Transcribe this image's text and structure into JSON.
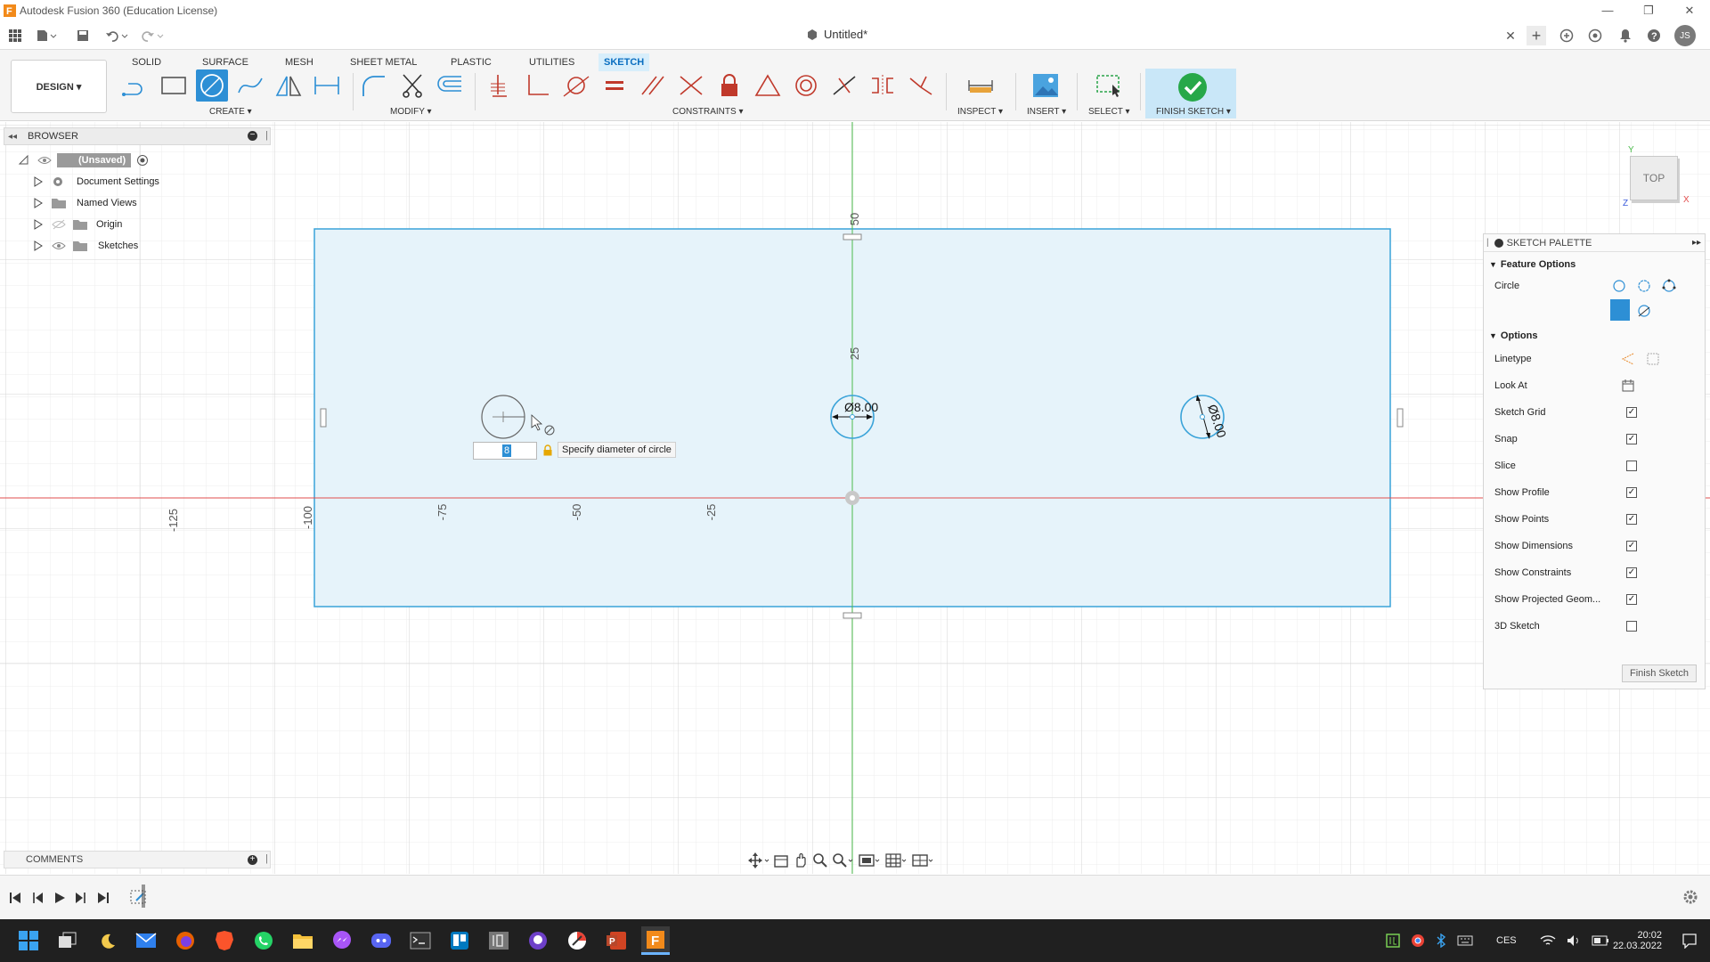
{
  "window": {
    "title": "Autodesk Fusion 360 (Education License)",
    "document_title": "Untitled*",
    "user_initials": "JS"
  },
  "workspace_tabs": [
    "SOLID",
    "SURFACE",
    "MESH",
    "SHEET METAL",
    "PLASTIC",
    "UTILITIES",
    "SKETCH"
  ],
  "active_workspace_tab": "SKETCH",
  "toolbar": {
    "design_label": "DESIGN ▾",
    "groups": {
      "create": "CREATE ▾",
      "modify": "MODIFY ▾",
      "constraints": "CONSTRAINTS ▾",
      "inspect": "INSPECT ▾",
      "insert": "INSERT ▾",
      "select": "SELECT ▾",
      "finish_sketch": "FINISH SKETCH ▾"
    },
    "active_tool": "circle-center-diameter"
  },
  "browser": {
    "title": "BROWSER",
    "root": "(Unsaved)",
    "items": [
      "Document Settings",
      "Named Views",
      "Origin",
      "Sketches"
    ]
  },
  "viewcube": {
    "face": "TOP",
    "axes": [
      "Y",
      "X",
      "Z"
    ]
  },
  "sketch": {
    "ruler_ticks_x": [
      "-125",
      "-100",
      "-75",
      "-50",
      "-25"
    ],
    "ruler_ticks_y": [
      "50",
      "25"
    ],
    "dimension_1": "Ø8.00",
    "dimension_2": "Ø8.00",
    "input_value": "8",
    "tooltip": "Specify diameter of circle"
  },
  "palette": {
    "title": "SKETCH PALETTE",
    "feature_options_label": "Feature Options",
    "circle_label": "Circle",
    "options_label": "Options",
    "options": [
      {
        "label": "Linetype",
        "kind": "icon"
      },
      {
        "label": "Look At",
        "kind": "icon"
      },
      {
        "label": "Sketch Grid",
        "kind": "check",
        "checked": true
      },
      {
        "label": "Snap",
        "kind": "check",
        "checked": true
      },
      {
        "label": "Slice",
        "kind": "check",
        "checked": false
      },
      {
        "label": "Show Profile",
        "kind": "check",
        "checked": true
      },
      {
        "label": "Show Points",
        "kind": "check",
        "checked": true
      },
      {
        "label": "Show Dimensions",
        "kind": "check",
        "checked": true
      },
      {
        "label": "Show Constraints",
        "kind": "check",
        "checked": true
      },
      {
        "label": "Show Projected Geom...",
        "kind": "check",
        "checked": true
      },
      {
        "label": "3D Sketch",
        "kind": "check",
        "checked": false
      }
    ],
    "finish_button": "Finish Sketch"
  },
  "comments": {
    "label": "COMMENTS"
  },
  "taskbar": {
    "language": "CES",
    "time": "20:02",
    "date": "22.03.2022"
  },
  "colors": {
    "accent": "#2d8fd5",
    "sketch_line": "#3aa3d9",
    "profile_fill": "#e6f3fa",
    "x_axis": "#e24c4c",
    "y_axis": "#4cbb4c",
    "taskbar": "#202020"
  }
}
